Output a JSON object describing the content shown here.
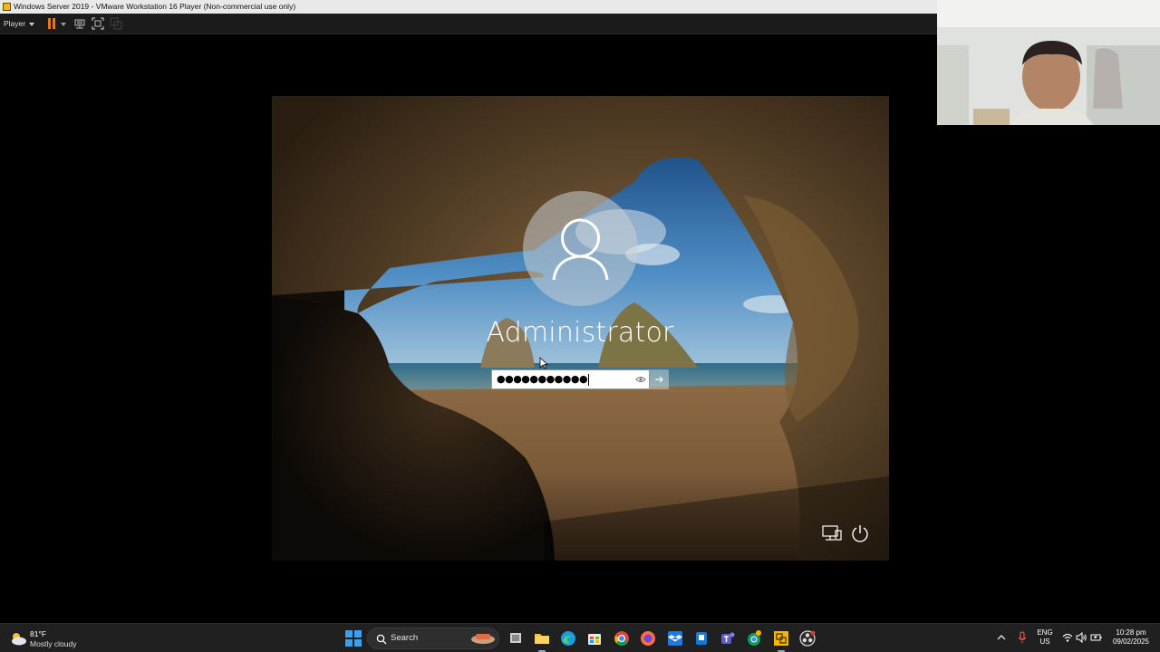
{
  "window": {
    "title": "Windows Server 2019 - VMware Workstation 16 Player (Non-commercial use only)"
  },
  "toolbar": {
    "player_label": "Player",
    "icons": [
      "pause-icon",
      "dropdown-caret-icon",
      "network-adapter-icon",
      "fullscreen-icon",
      "unity-icon"
    ]
  },
  "lockscreen": {
    "user_name": "Administrator",
    "password_masked": "●●●●●●●●●●●",
    "icons": [
      "user-avatar-icon",
      "reveal-password-icon",
      "submit-arrow-icon",
      "network-icon",
      "power-icon"
    ]
  },
  "taskbar": {
    "weather": {
      "temp": "81°F",
      "condition": "Mostly cloudy"
    },
    "search_label": "Search",
    "apps": [
      "start-icon",
      "task-view-icon",
      "file-explorer-icon",
      "edge-icon",
      "store-icon",
      "chrome-icon",
      "firefox-icon",
      "dropbox-icon",
      "app-icon",
      "teams-icon",
      "chrome-profile-icon",
      "vmware-icon",
      "obs-icon"
    ],
    "tray": {
      "lang_line1": "ENG",
      "lang_line2": "US",
      "time": "10:28 pm",
      "date": "09/02/2025"
    }
  },
  "colors": {
    "accent_pause": "#e2761b",
    "taskbar_bg": "#202020",
    "windows_blue": "#3aa0f0"
  }
}
